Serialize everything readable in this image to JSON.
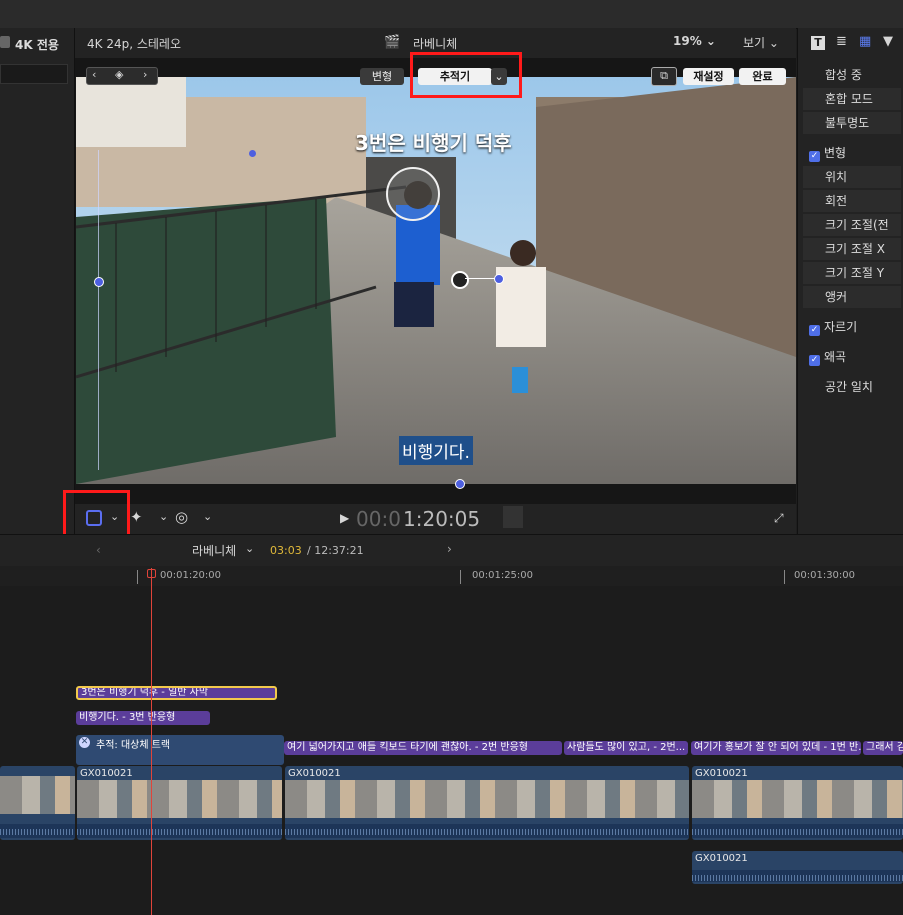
{
  "left_panel": {
    "badge": "4K 전용"
  },
  "viewer": {
    "format": "4K 24p, 스테레오",
    "project": "라베니체",
    "zoom": "19%",
    "view_menu": "보기",
    "mode_transform": "변형",
    "mode_tracker": "추적기",
    "reset": "재설정",
    "done": "완료",
    "title_overlay": "3번은 비행기 덕후",
    "subtitle_overlay": "비행기다.",
    "timecode_dim": "00:0",
    "timecode": "1:20:05"
  },
  "inspector": {
    "items": [
      {
        "label": "합성 중",
        "checked": false,
        "sub": false
      },
      {
        "label": "혼합 모드",
        "checked": false,
        "sub": true
      },
      {
        "label": "불투명도",
        "checked": false,
        "sub": true
      },
      {
        "label": "변형",
        "checked": true,
        "sub": false
      },
      {
        "label": "위치",
        "checked": false,
        "sub": true
      },
      {
        "label": "회전",
        "checked": false,
        "sub": true
      },
      {
        "label": "크기 조절(전체)",
        "checked": false,
        "sub": true
      },
      {
        "label": "크기 조절 X",
        "checked": false,
        "sub": true
      },
      {
        "label": "크기 조절 Y",
        "checked": false,
        "sub": true
      },
      {
        "label": "앵커",
        "checked": false,
        "sub": true
      },
      {
        "label": "자르기",
        "checked": true,
        "sub": false
      },
      {
        "label": "왜곡",
        "checked": true,
        "sub": false
      },
      {
        "label": "공간 일치",
        "checked": false,
        "sub": false
      }
    ]
  },
  "timeline": {
    "project": "라베니체",
    "position": "03:03",
    "duration": "/ 12:37:21",
    "ruler": [
      "00:01:20:00",
      "00:01:25:00",
      "00:01:30:00"
    ],
    "titles": {
      "t1": "3번은 비행기 덕후 - 일반 자막",
      "t2": "비행기다. - 3번 반응형",
      "t3": "여기 넓어가지고 애들 킥보드 타기에 괜찮아. - 2번 반응형",
      "t4": "사람들도 많이 있고, - 2번...",
      "t5": "여기가 홍보가 잘 안 되어 있데 - 1번 반...",
      "t6": "그래서 김"
    },
    "tracker": "추적: 대상체 트랙",
    "clips": [
      "GX010021",
      "GX010021",
      "GX010021",
      "GX010021"
    ]
  },
  "colors": {
    "accent": "#4f6fe8",
    "playhead": "#e0443a",
    "highlight": "#ff1a1a",
    "title_clip": "#5b3d9a",
    "video_clip": "#2a4466"
  }
}
